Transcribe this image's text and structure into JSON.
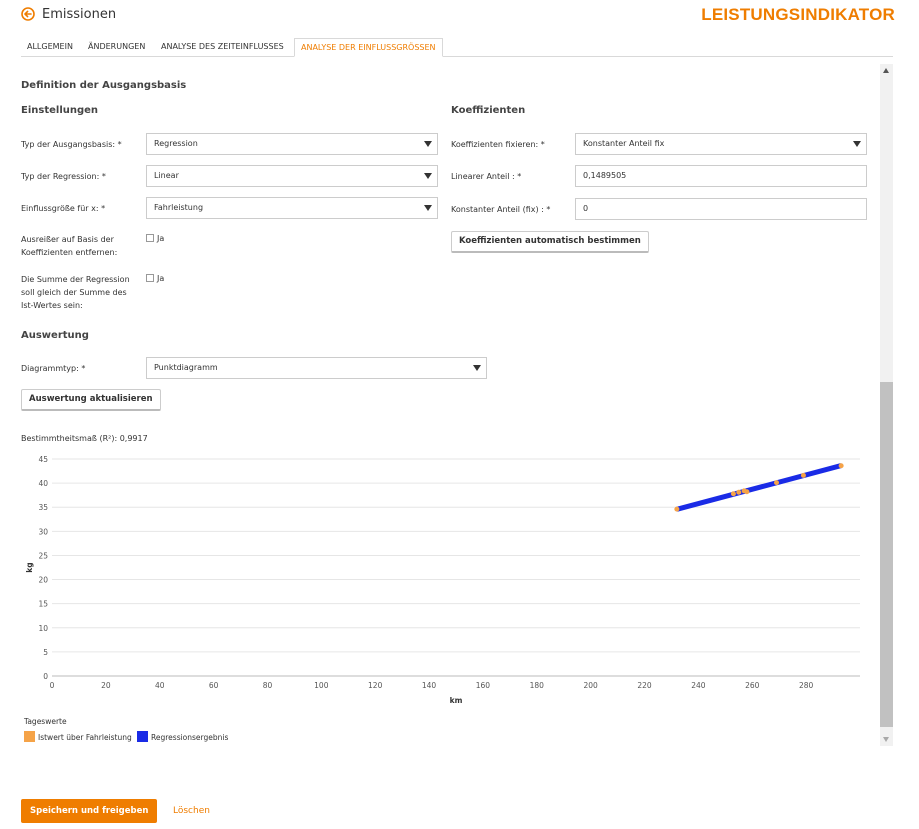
{
  "header": {
    "title": "Emissionen",
    "brand": "LEISTUNGSINDIKATOR",
    "accent_color": "#ef7d00"
  },
  "tabs": [
    {
      "label": "ALLGEMEIN",
      "active": false
    },
    {
      "label": "ÄNDERUNGEN",
      "active": false
    },
    {
      "label": "ANALYSE DES ZEITEINFLUSSES",
      "active": false
    },
    {
      "label": "ANALYSE DER EINFLUSSGRÖSSEN",
      "active": true
    }
  ],
  "baseline": {
    "title": "Definition der Ausgangsbasis",
    "settings": {
      "title": "Einstellungen",
      "baseline_type_label": "Typ der Ausgangsbasis: *",
      "baseline_type_value": "Regression",
      "regression_type_label": "Typ der Regression: *",
      "regression_type_value": "Linear",
      "x_factor_label": "Einflussgröße für x: *",
      "x_factor_value": "Fahrleistung",
      "outliers_label": "Ausreißer auf Basis der Koeffizienten entfernen:",
      "outliers_option": "Ja",
      "sum_label": "Die Summe der Regression soll gleich der Summe des Ist-Wertes sein:",
      "sum_option": "Ja"
    },
    "coefficients": {
      "title": "Koeffizienten",
      "fix_label": "Koeffizienten fixieren: *",
      "fix_value": "Konstanter Anteil fix",
      "linear_label": "Linearer Anteil : *",
      "linear_value": "0,1489505",
      "constant_label": "Konstanter Anteil (fix) : *",
      "constant_value": "0",
      "auto_button": "Koeffizienten automatisch bestimmen"
    }
  },
  "evaluation": {
    "title": "Auswertung",
    "chart_type_label": "Diagrammtyp: *",
    "chart_type_value": "Punktdiagramm",
    "update_button": "Auswertung aktualisieren",
    "r2_text": "Bestimmtheitsmaß (R²): 0,9917"
  },
  "chart_data": {
    "type": "scatter",
    "xlabel": "km",
    "ylabel": "kg",
    "xlim": [
      0,
      300
    ],
    "ylim": [
      0,
      45
    ],
    "x_ticks": [
      0,
      20,
      40,
      60,
      80,
      100,
      120,
      140,
      160,
      180,
      200,
      220,
      240,
      260,
      280
    ],
    "y_ticks": [
      0,
      5,
      10,
      15,
      20,
      25,
      30,
      35,
      40,
      45
    ],
    "grid": true,
    "legend_title": "Tageswerte",
    "legend_placement": "bottom-left",
    "series": [
      {
        "name": "Istwert über Fahrleistung",
        "color": "#f5a348",
        "points": [
          [
            232,
            34.6
          ],
          [
            253,
            37.8
          ],
          [
            255,
            38.1
          ],
          [
            257,
            38.4
          ],
          [
            258,
            38.2
          ],
          [
            269,
            40.1
          ],
          [
            279,
            41.6
          ],
          [
            293,
            43.6
          ]
        ]
      },
      {
        "name": "Regressionsergebnis",
        "color": "#1a2be6",
        "line": [
          [
            232,
            34.56
          ],
          [
            293,
            43.64
          ]
        ]
      }
    ]
  },
  "footer": {
    "save_button": "Speichern und freigeben",
    "delete_link": "Löschen"
  }
}
